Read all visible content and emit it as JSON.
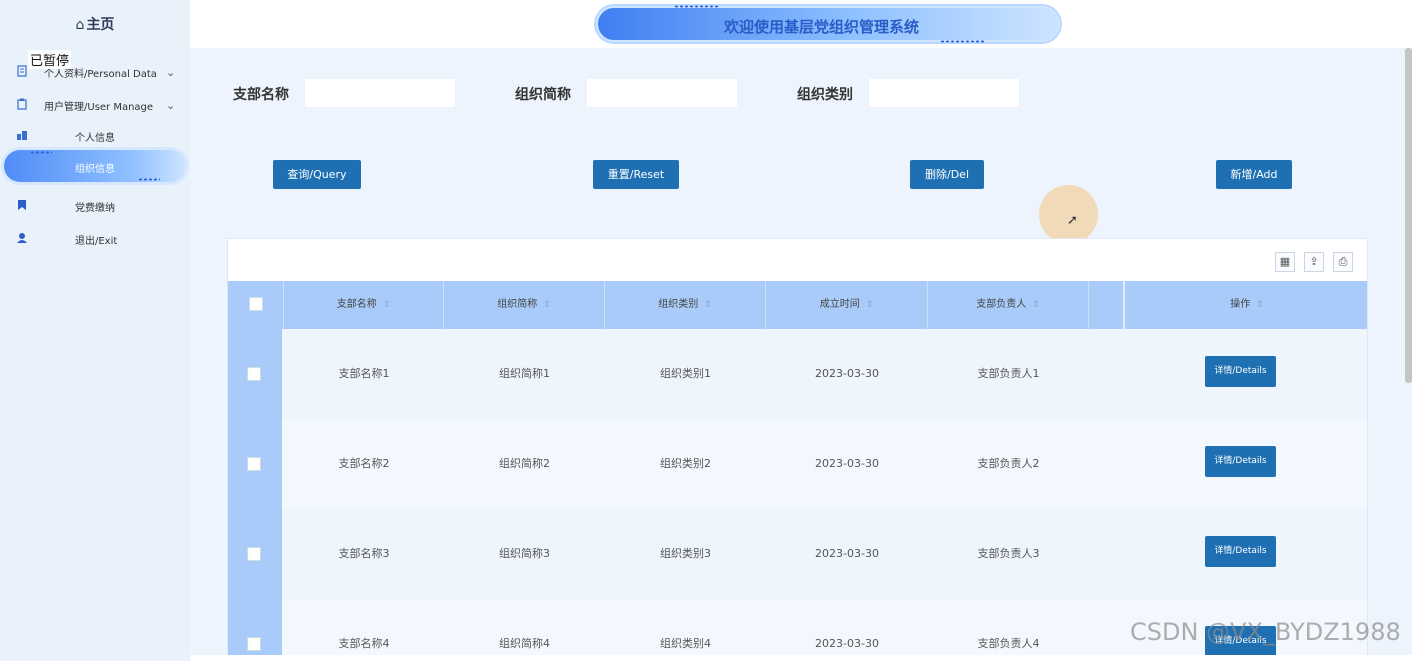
{
  "header": {
    "title": "欢迎使用基层党组织管理系统"
  },
  "sidebar": {
    "home": "主页",
    "overlay_text": "已暂停",
    "items": [
      {
        "label": "个人资料/Personal Data",
        "expandable": true
      },
      {
        "label": "用户管理/User Manage",
        "expandable": true
      },
      {
        "label": "个人信息",
        "expandable": false
      },
      {
        "label": "组织信息",
        "expandable": false,
        "active": true
      },
      {
        "label": "党费缴纳",
        "expandable": false
      },
      {
        "label": "退出/Exit",
        "expandable": false
      }
    ]
  },
  "search": {
    "fields": [
      {
        "label": "支部名称",
        "value": ""
      },
      {
        "label": "组织简称",
        "value": ""
      },
      {
        "label": "组织类别",
        "value": ""
      }
    ],
    "buttons": {
      "query": "查询/Query",
      "reset": "重置/Reset",
      "delete": "删除/Del",
      "add": "新增/Add"
    }
  },
  "table": {
    "columns": [
      "支部名称",
      "组织简称",
      "组织类别",
      "成立时间",
      "支部负责人",
      "操作"
    ],
    "rows": [
      [
        "支部名称1",
        "组织简称1",
        "组织类别1",
        "2023-03-30",
        "支部负责人1"
      ],
      [
        "支部名称2",
        "组织简称2",
        "组织类别2",
        "2023-03-30",
        "支部负责人2"
      ],
      [
        "支部名称3",
        "组织简称3",
        "组织类别3",
        "2023-03-30",
        "支部负责人3"
      ],
      [
        "支部名称4",
        "组织简称4",
        "组织类别4",
        "2023-03-30",
        "支部负责人4"
      ]
    ],
    "details_label": "详情/Details"
  },
  "watermark": "CSDN @VX_BYDZ1988",
  "colors": {
    "primary_button": "#1f70b3",
    "table_header": "#a9cbf9",
    "sidebar_bg": "#e9f1fb"
  }
}
